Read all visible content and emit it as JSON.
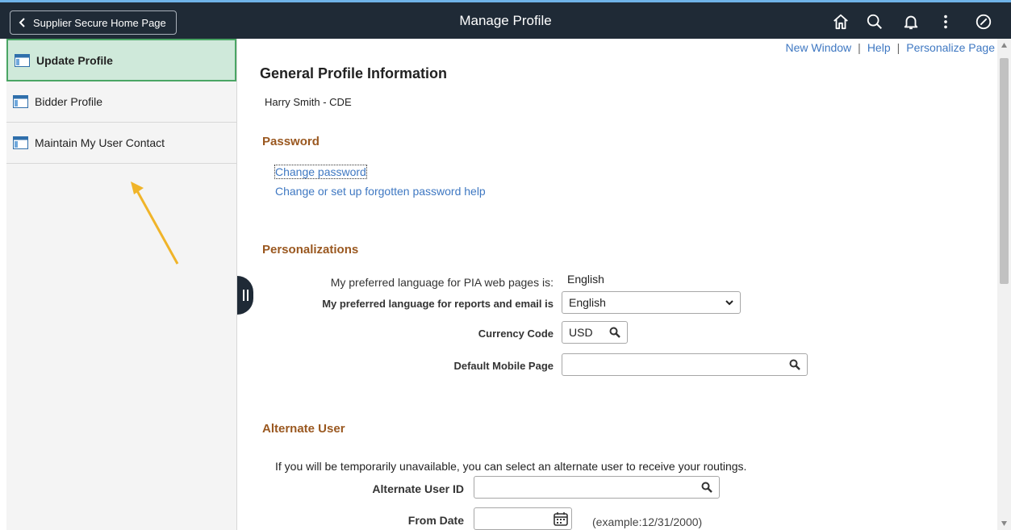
{
  "header": {
    "back_label": "Supplier Secure Home Page",
    "title": "Manage Profile",
    "icons": [
      "home-icon",
      "search-icon",
      "bell-icon",
      "more-vertical-icon",
      "compass-icon"
    ]
  },
  "sidebar": {
    "items": [
      {
        "label": "Update Profile",
        "active": true
      },
      {
        "label": "Bidder Profile",
        "active": false
      },
      {
        "label": "Maintain My User Contact",
        "active": false
      }
    ]
  },
  "toplinks": {
    "new_window": "New Window",
    "help": "Help",
    "personalize": "Personalize Page",
    "separator": "|"
  },
  "main": {
    "heading": "General Profile Information",
    "user_name": "Harry Smith - CDE",
    "password": {
      "title": "Password",
      "change_link": "Change password",
      "help_link": "Change or set up forgotten password help"
    },
    "personalizations": {
      "title": "Personalizations",
      "pia_label": "My preferred language for PIA web pages is:",
      "pia_value": "English",
      "report_label": "My preferred language for reports and email is",
      "report_value": "English",
      "currency_label": "Currency Code",
      "currency_value": "USD",
      "mobile_label": "Default Mobile Page",
      "mobile_value": ""
    },
    "alternate": {
      "title": "Alternate User",
      "instruction": "If you will be temporarily unavailable, you can select an alternate user to receive your routings.",
      "user_id_label": "Alternate User ID",
      "user_id_value": "",
      "from_date_label": "From Date",
      "from_date_value": "",
      "example": "(example:12/31/2000)"
    }
  },
  "colors": {
    "topbar": "#1f2a36",
    "active_bg": "#cfe9da",
    "active_border": "#4aa564",
    "section_title": "#9a5820",
    "link": "#3f78c2",
    "arrow": "#f0b429"
  }
}
